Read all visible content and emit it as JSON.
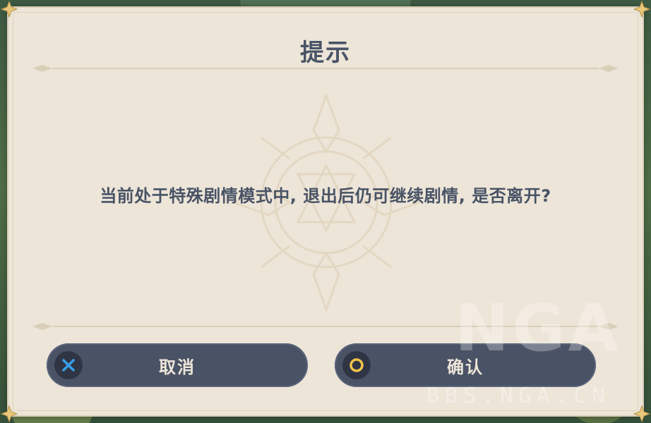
{
  "dialog": {
    "title": "提示",
    "message": "当前处于特殊剧情模式中, 退出后仍可继续剧情, 是否离开?"
  },
  "buttons": {
    "cancel": {
      "label": "取消",
      "icon": "cross-icon",
      "icon_color": "#3a9ee8"
    },
    "confirm": {
      "label": "确认",
      "icon": "circle-icon",
      "icon_color": "#f2c44b"
    }
  },
  "watermark": {
    "logo": "NGA",
    "url": "BBS.NGA.CN"
  },
  "colors": {
    "panel": "#ece5d8",
    "text": "#495366",
    "button": "#4a5366",
    "button_text": "#ece5d8"
  }
}
